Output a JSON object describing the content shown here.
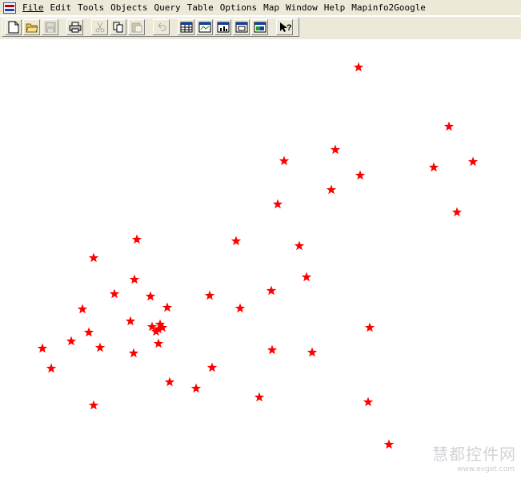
{
  "menubar": {
    "items": [
      {
        "label": "File"
      },
      {
        "label": "Edit"
      },
      {
        "label": "Tools"
      },
      {
        "label": "Objects"
      },
      {
        "label": "Query"
      },
      {
        "label": "Table"
      },
      {
        "label": "Options"
      },
      {
        "label": "Map"
      },
      {
        "label": "Window"
      },
      {
        "label": "Help"
      },
      {
        "label": "Mapinfo2Google"
      }
    ]
  },
  "toolbar": {
    "buttons": [
      {
        "icon": "new-icon",
        "enabled": true
      },
      {
        "icon": "open-folder-icon",
        "enabled": true
      },
      {
        "icon": "save-icon",
        "enabled": false
      },
      {
        "icon": "print-icon",
        "enabled": true
      },
      {
        "icon": "cut-icon",
        "enabled": false
      },
      {
        "icon": "copy-icon",
        "enabled": true
      },
      {
        "icon": "paste-icon",
        "enabled": false
      },
      {
        "icon": "undo-icon",
        "enabled": false
      },
      {
        "icon": "new-browser-icon",
        "enabled": true
      },
      {
        "icon": "new-mapper-icon",
        "enabled": true
      },
      {
        "icon": "new-grapher-icon",
        "enabled": true
      },
      {
        "icon": "new-layout-icon",
        "enabled": true
      },
      {
        "icon": "new-redistrict-icon",
        "enabled": true
      },
      {
        "icon": "help-pointer-icon",
        "enabled": true
      }
    ]
  },
  "map": {
    "marker_color": "#ff0000",
    "marker_symbol": "star"
  },
  "watermark": {
    "text": "慧都控件网",
    "url": "www.evget.com"
  }
}
